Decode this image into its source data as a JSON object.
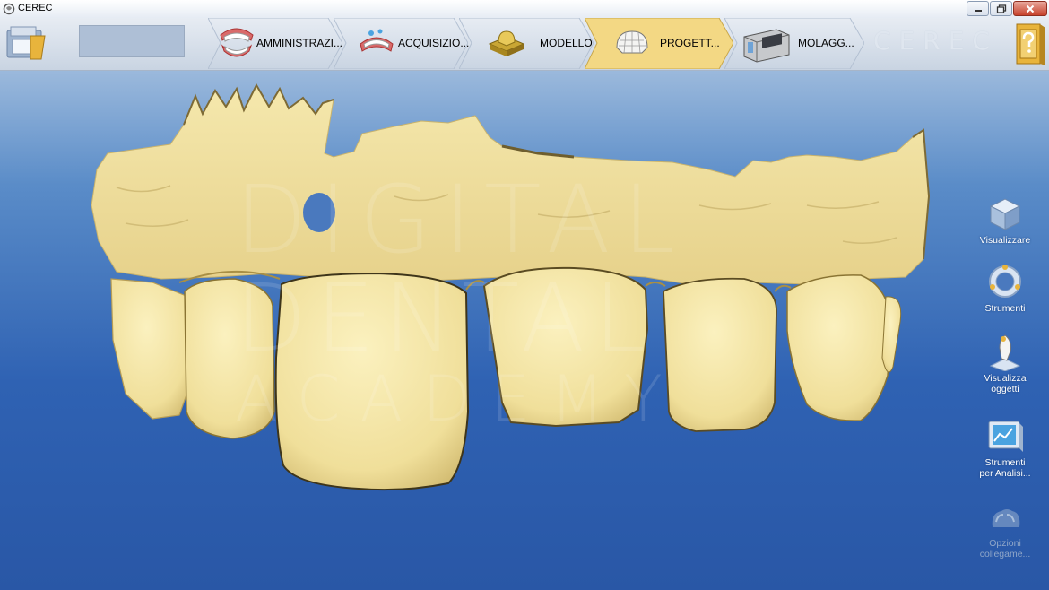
{
  "window": {
    "title": "CEREC"
  },
  "toolbar": {
    "steps": [
      {
        "label": "AMMINISTRAZI...",
        "icon": "dentures-icon",
        "active": false
      },
      {
        "label": "ACQUISIZIO...",
        "icon": "scan-arch-icon",
        "active": false
      },
      {
        "label": "MODELLO",
        "icon": "model-tooth-icon",
        "active": false
      },
      {
        "label": "PROGETT...",
        "icon": "design-crown-icon",
        "active": true
      },
      {
        "label": "MOLAGG...",
        "icon": "milling-unit-icon",
        "active": false
      }
    ],
    "brand": "CEREC"
  },
  "sidebar": {
    "items": [
      {
        "label": "Visualizzare",
        "icon": "view-cube-icon",
        "enabled": true
      },
      {
        "label": "Strumenti",
        "icon": "tools-ring-icon",
        "enabled": true
      },
      {
        "label_line1": "Visualizza",
        "label_line2": "oggetti",
        "icon": "view-objects-icon",
        "enabled": true
      },
      {
        "label_line1": "Strumenti",
        "label_line2": "per Analisi...",
        "icon": "analysis-tools-icon",
        "enabled": true
      },
      {
        "label_line1": "Opzioni",
        "label_line2": "collegame...",
        "icon": "link-options-icon",
        "enabled": false
      }
    ]
  },
  "watermark": {
    "line1": "DIGITAL",
    "line2": "DENTAL",
    "line3": "ACADEMY"
  },
  "colors": {
    "model": "#f2e4a4",
    "active_step": "#f3d884",
    "viewport_bottom": "#2957a6"
  }
}
